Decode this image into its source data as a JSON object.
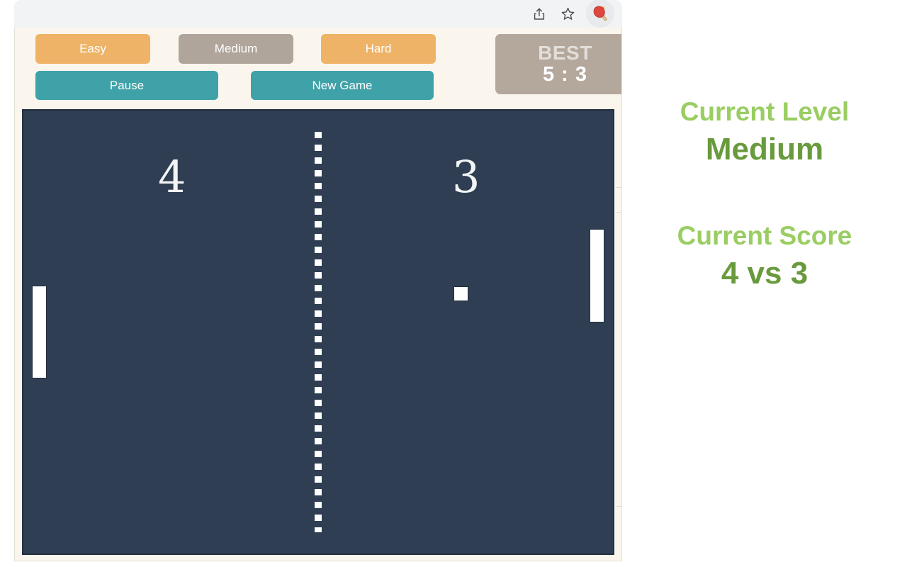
{
  "browser": {
    "toolbar_icons": [
      {
        "name": "share-icon",
        "glyph": "share"
      },
      {
        "name": "bookmark-star-icon",
        "glyph": "star"
      }
    ],
    "extension_icon": {
      "name": "ping-pong-paddle-icon",
      "title": "Ping Pong",
      "ball_color": "#f5a623",
      "paddle_color": "#e0453f",
      "handle_color": "#d8b07a"
    }
  },
  "popup": {
    "background_color": "#faf6ee",
    "difficulty_buttons": [
      {
        "label": "Easy",
        "color": "#eeb367",
        "active": false
      },
      {
        "label": "Medium",
        "color": "#b0a59b",
        "active": true
      },
      {
        "label": "Hard",
        "color": "#eeb367",
        "active": false
      }
    ],
    "action_buttons": [
      {
        "label": "Pause",
        "color": "#3fa2a8"
      },
      {
        "label": "New Game",
        "color": "#3fa2a8"
      }
    ],
    "best": {
      "label": "BEST",
      "score": "5 : 3",
      "background_color": "#b4a89d"
    },
    "board": {
      "background_color": "#2f3e52",
      "left_score": "4",
      "right_score": "3",
      "element_color": "#ffffff"
    }
  },
  "status_panel": {
    "level": {
      "label": "Current Level",
      "value": "Medium"
    },
    "score": {
      "label": "Current Score",
      "value": "4 vs 3"
    },
    "label_color": "#9acd62",
    "value_color": "#699a3d"
  }
}
